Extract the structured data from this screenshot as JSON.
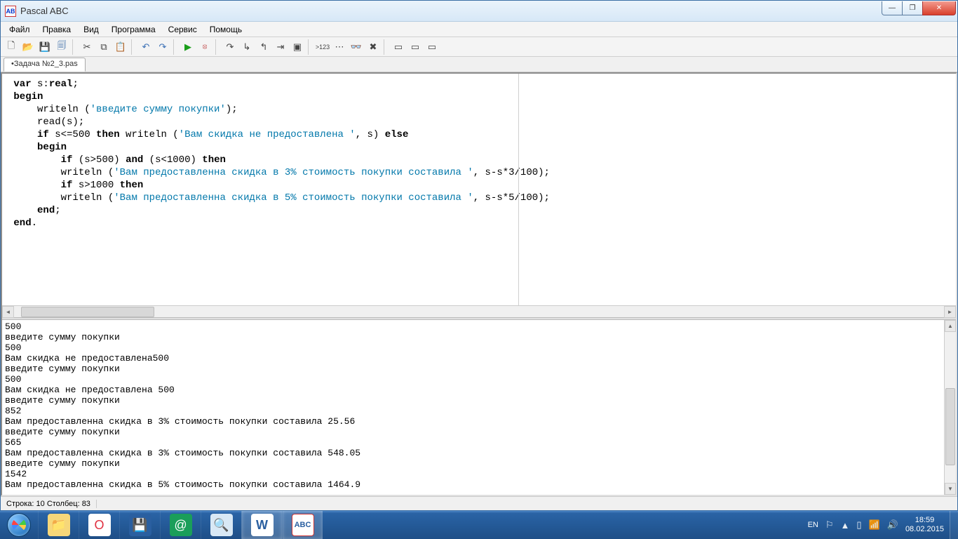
{
  "window": {
    "title": "Pascal ABC"
  },
  "menu": {
    "file": "Файл",
    "edit": "Правка",
    "view": "Вид",
    "program": "Программа",
    "service": "Сервис",
    "help": "Помощь"
  },
  "tabs": {
    "current": "Задача №2_3.pas",
    "dirty_prefix": "•"
  },
  "code": {
    "tokens": [
      {
        "t": " ",
        "c": ""
      },
      {
        "t": "var",
        "c": "kw"
      },
      {
        "t": " s:",
        "c": ""
      },
      {
        "t": "real",
        "c": "kw"
      },
      {
        "t": ";\n ",
        "c": ""
      },
      {
        "t": "begin",
        "c": "kw"
      },
      {
        "t": "\n     writeln (",
        "c": ""
      },
      {
        "t": "'введите сумму покупки'",
        "c": "str"
      },
      {
        "t": ");\n     read(s);\n     ",
        "c": ""
      },
      {
        "t": "if",
        "c": "kw"
      },
      {
        "t": " s<=500 ",
        "c": ""
      },
      {
        "t": "then",
        "c": "kw"
      },
      {
        "t": " writeln (",
        "c": ""
      },
      {
        "t": "'Вам скидка не предоставлена '",
        "c": "str"
      },
      {
        "t": ", s) ",
        "c": ""
      },
      {
        "t": "else",
        "c": "kw"
      },
      {
        "t": "\n     ",
        "c": ""
      },
      {
        "t": "begin",
        "c": "kw"
      },
      {
        "t": "\n         ",
        "c": ""
      },
      {
        "t": "if",
        "c": "kw"
      },
      {
        "t": " (s>500) ",
        "c": ""
      },
      {
        "t": "and",
        "c": "kw"
      },
      {
        "t": " (s<1000) ",
        "c": ""
      },
      {
        "t": "then",
        "c": "kw"
      },
      {
        "t": "\n         writeln (",
        "c": ""
      },
      {
        "t": "'Вам предоставленна скидка в 3% стоимость покупки составила '",
        "c": "str"
      },
      {
        "t": ", s-s*3/100);\n         ",
        "c": ""
      },
      {
        "t": "if",
        "c": "kw"
      },
      {
        "t": " s>1000 ",
        "c": ""
      },
      {
        "t": "then",
        "c": "kw"
      },
      {
        "t": "\n         writeln (",
        "c": ""
      },
      {
        "t": "'Вам предоставленна скидка в 5% стоимость покупки составила '",
        "c": "str"
      },
      {
        "t": ", s-s*5/100);\n     ",
        "c": ""
      },
      {
        "t": "end",
        "c": "kw"
      },
      {
        "t": ";\n ",
        "c": ""
      },
      {
        "t": "end",
        "c": "kw"
      },
      {
        "t": ".",
        "c": ""
      }
    ]
  },
  "output": [
    "500",
    "введите сумму покупки",
    "500",
    "Вам скидка не предоставлена500",
    "введите сумму покупки",
    "500",
    "Вам скидка не предоставлена 500",
    "введите сумму покупки",
    "852",
    "Вам предоставленна скидка в 3% стоимость покупки составила 25.56",
    "введите сумму покупки",
    "565",
    "Вам предоставленна скидка в 3% стоимость покупки составила 548.05",
    "введите сумму покупки",
    "1542",
    "Вам предоставленна скидка в 5% стоимость покупки составила 1464.9"
  ],
  "status": {
    "line_label": "Строка: ",
    "line": "10",
    "col_label": "   Столбец: ",
    "col": "83"
  },
  "tray": {
    "lang": "EN",
    "time": "18:59",
    "date": "08.02.2015"
  },
  "toolbar_icons": {
    "new": "🗋",
    "open": "📂",
    "save": "💾",
    "saveall": "🗐",
    "cut": "✂",
    "copy": "⧉",
    "paste": "📋",
    "undo": "↶",
    "redo": "↷",
    "run": "▶",
    "stop": "⦻",
    "stepover": "↷",
    "stepinto": "↳",
    "stepout": "↰",
    "runto": "⇥",
    "breakpoint": "▣",
    "watch": ">123",
    "eval": "⋯",
    "locals": "👓",
    "clear": "✖",
    "win1": "▭",
    "win2": "▭",
    "win3": "▭"
  },
  "colors": {
    "run": "#1a9e1a",
    "stop": "#c04848"
  }
}
